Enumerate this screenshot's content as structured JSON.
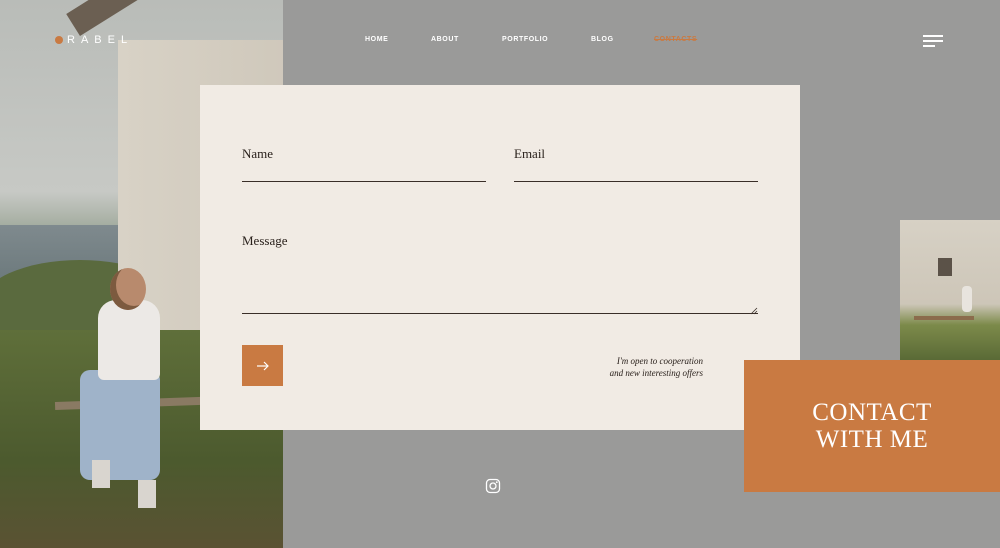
{
  "brand": {
    "logo_text": "RABEL",
    "accent": "#c97a42"
  },
  "nav": {
    "items": [
      {
        "label": "HOME"
      },
      {
        "label": "ABOUT"
      },
      {
        "label": "PORTFOLIO"
      },
      {
        "label": "BLOG"
      },
      {
        "label": "CONTACTS"
      }
    ],
    "active": "CONTACTS"
  },
  "form": {
    "name_label": "Name",
    "email_label": "Email",
    "message_label": "Message",
    "note_line1": "I'm open to cooperation",
    "note_line2": "and new interesting offers"
  },
  "contact": {
    "line1": "CONTACT",
    "line2": "WITH ME"
  },
  "icons": {
    "send": "arrow-right-icon",
    "social": "instagram-icon",
    "menu": "hamburger-menu-icon"
  },
  "colors": {
    "background": "#9a9a99",
    "card": "#f1ebe4",
    "accent": "#c97a42"
  }
}
